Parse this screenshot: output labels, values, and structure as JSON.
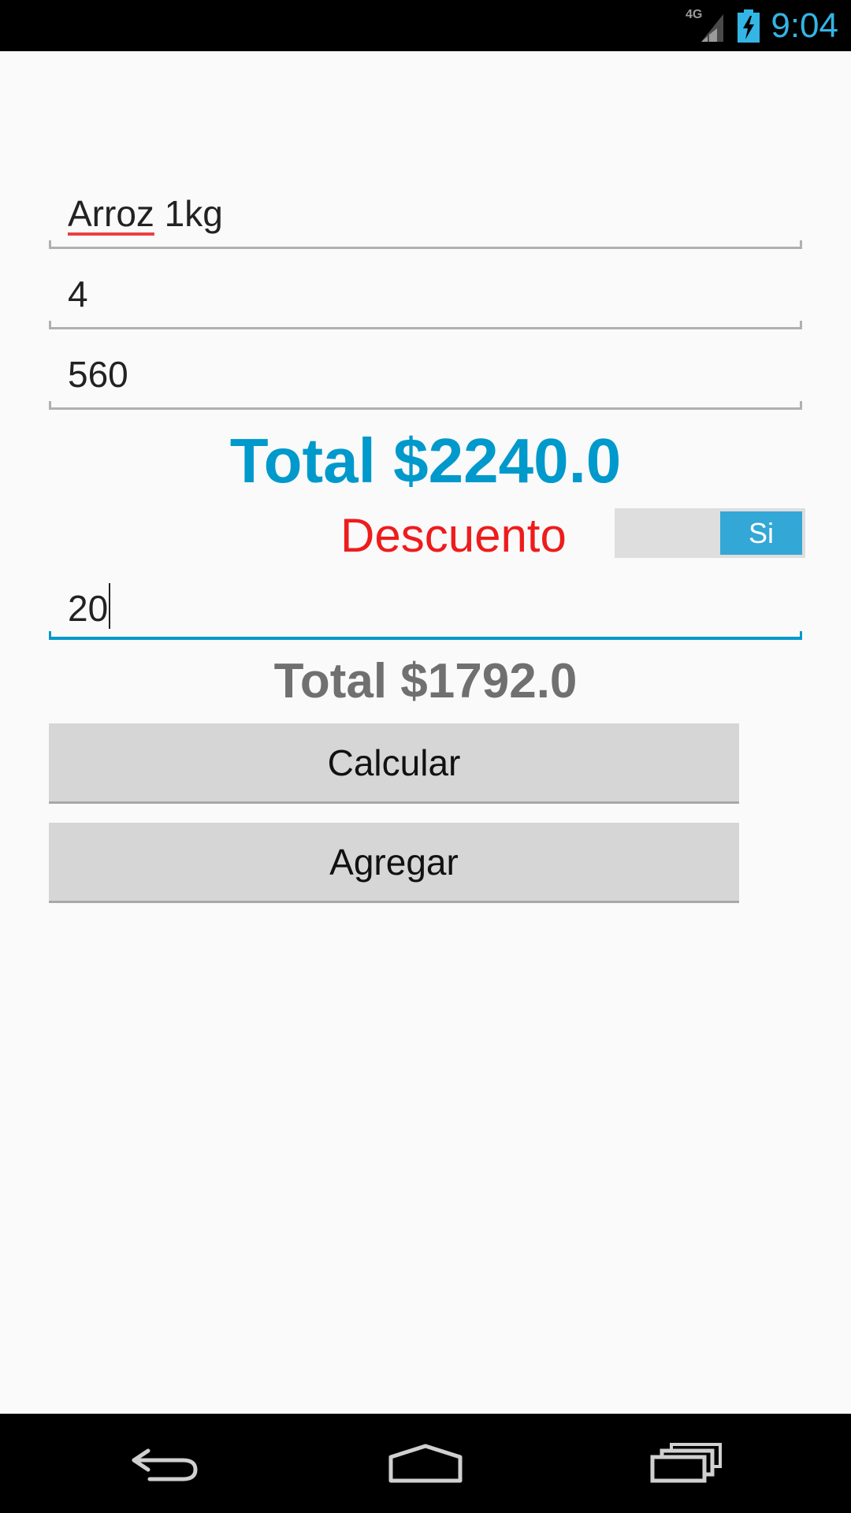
{
  "status_bar": {
    "network": "4G",
    "time": "9:04",
    "icons": [
      "signal-4g-icon",
      "battery-charging-icon"
    ]
  },
  "form": {
    "product": {
      "prefix": "Arroz",
      "suffix": " 1kg"
    },
    "quantity": "4",
    "price": "560",
    "total_label": "Total $2240.0",
    "discount_label": "Descuento",
    "discount_switch": {
      "state": "Si",
      "on": true
    },
    "discount_value": "20",
    "discounted_total_label": "Total $1792.0",
    "calculate_button": "Calcular",
    "add_button": "Agregar"
  },
  "nav_bar": {
    "icons": [
      "back-icon",
      "home-icon",
      "recent-apps-icon"
    ]
  },
  "colors": {
    "accent": "#0099cc",
    "discount_label": "#ee1c1c",
    "status_time": "#33b5e5",
    "switch_on": "#33a7d6"
  }
}
